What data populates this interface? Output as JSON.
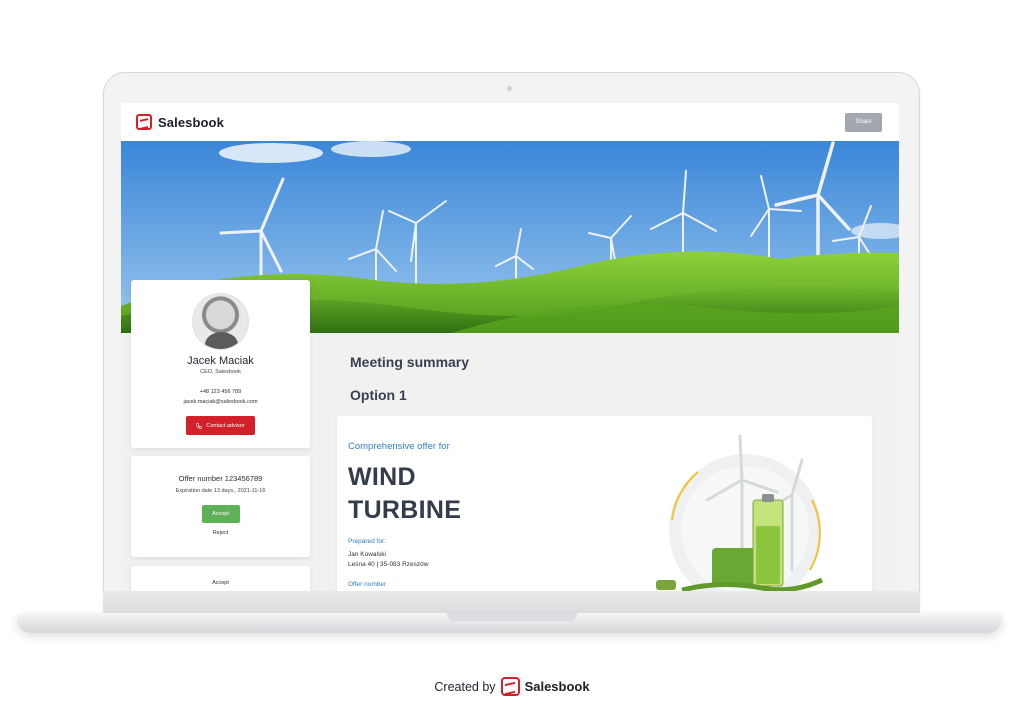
{
  "app": {
    "brand": "Salesbook",
    "share_label": "Share"
  },
  "advisor": {
    "name": "Jacek Maciak",
    "role": "CEO, Salesbook",
    "phone": "+48 123 456 789",
    "email": "jacek.maciak@salesbook.com",
    "contact_label": "Contact advisor"
  },
  "offer": {
    "number_text": "Offer number 123456789",
    "expiration_text": "Expiration date 13 days,, 2021-11-16",
    "accept_label": "Accept",
    "reject_label": "Reject"
  },
  "accept_card": {
    "label": "Accept"
  },
  "main": {
    "meeting_title": "Meeting summary",
    "option_title": "Option 1",
    "offer_for": "Comprehensive offer for",
    "headline_line1": "WIND",
    "headline_line2": "TURBINE",
    "prepared_for": "Prepared for:",
    "client_name": "Jan Kowalski",
    "client_address": "Leśna 40 | 35-083 Rzeszów",
    "offer_number_label": "Offer number"
  },
  "footer": {
    "created_by": "Created by",
    "brand": "Salesbook"
  },
  "colors": {
    "brand_red": "#d3202a",
    "accept_green": "#5fb058",
    "link_blue": "#2f7fd0",
    "share_gray": "#a3a7b0"
  },
  "icons": {
    "logo": "salesbook-logo-icon",
    "contact": "phone-icon"
  }
}
